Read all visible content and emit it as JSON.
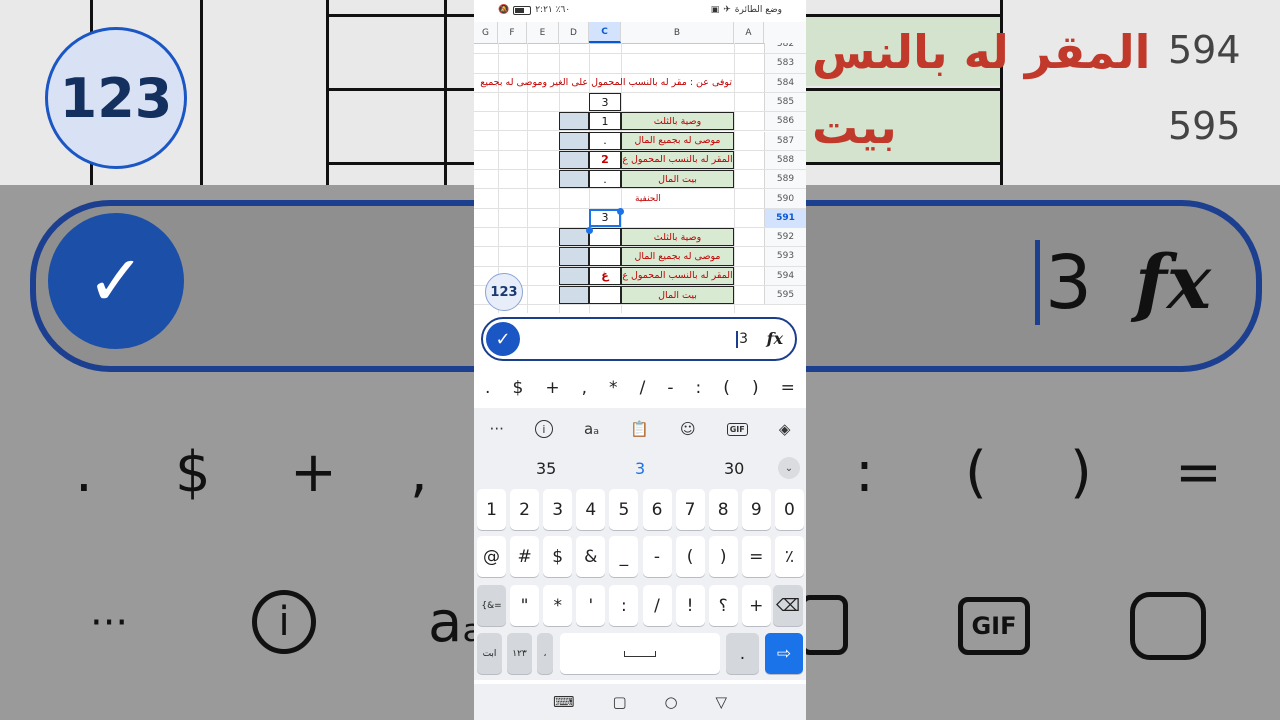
{
  "status": {
    "left_icons": "٦٠٪ ٢:٢١",
    "right_text": "وضع الطائرة"
  },
  "columns": [
    "A",
    "B",
    "C",
    "D",
    "E",
    "F",
    "G"
  ],
  "selected_column": "C",
  "rows": [
    {
      "num": "582",
      "b": "",
      "c": "",
      "type": "plain"
    },
    {
      "num": "583",
      "b": "",
      "c": "",
      "type": "plain"
    },
    {
      "num": "584",
      "b": "توفى عن : مقر له بالنسب المحمول على الغير وموصى له بجميع",
      "c": "",
      "type": "title"
    },
    {
      "num": "585",
      "b": "",
      "c": "3",
      "type": "head"
    },
    {
      "num": "586",
      "b": "وصية بالثلث",
      "c": "1",
      "type": "item"
    },
    {
      "num": "587",
      "b": "موصى له بجميع المال",
      "c": ".",
      "type": "item"
    },
    {
      "num": "588",
      "b": "المقر له بالنسب المحمول ع",
      "c": "2",
      "type": "item_red"
    },
    {
      "num": "589",
      "b": "بيت المال",
      "c": ".",
      "type": "item"
    },
    {
      "num": "590",
      "b": "الحنفية",
      "c": "",
      "type": "label"
    },
    {
      "num": "591",
      "b": "",
      "c": "3",
      "type": "selected"
    },
    {
      "num": "592",
      "b": "وصية بالثلث",
      "c": "",
      "type": "item"
    },
    {
      "num": "593",
      "b": "موصى له بجميع المال",
      "c": "",
      "type": "item"
    },
    {
      "num": "594",
      "b": "المقر له بالنسب المحمول ع",
      "c": "غ",
      "type": "item_red"
    },
    {
      "num": "595",
      "b": "بيت المال",
      "c": "",
      "type": "item"
    }
  ],
  "formula": {
    "value": "3",
    "fx_label": "fx"
  },
  "badge": "123",
  "keyboard": {
    "symbols": [
      ".",
      "$",
      "+",
      ",",
      "*",
      "/",
      "-",
      ":",
      "(",
      ")",
      "="
    ],
    "suggestions": [
      "35",
      "3",
      "30"
    ],
    "numbers": [
      "1",
      "2",
      "3",
      "4",
      "5",
      "6",
      "7",
      "8",
      "9",
      "0"
    ],
    "row2": [
      "@",
      "#",
      "$",
      "&",
      "_",
      "-",
      "(",
      ")",
      "=",
      "٪"
    ],
    "row3": [
      "{&=",
      "\"",
      "*",
      "'",
      ":",
      "/",
      "!",
      "؟",
      "+"
    ],
    "row4_left": [
      "ابت",
      "١٢٣",
      "،"
    ],
    "row4_right": "."
  },
  "background_zoom": {
    "text1": "المقر له بالنس",
    "text2": "بيت",
    "num1": "594",
    "num2": "595",
    "badge": "123",
    "value": "3",
    "fx": "fx",
    "symbols": [
      ".",
      "$",
      "+",
      ",",
      ":",
      "(",
      ")",
      "="
    ],
    "gif": "GIF"
  },
  "colors": {
    "accent": "#1a73e8",
    "text_red": "#c00000",
    "cell_green": "#d9ead3",
    "cell_blue": "#d0dde8"
  }
}
